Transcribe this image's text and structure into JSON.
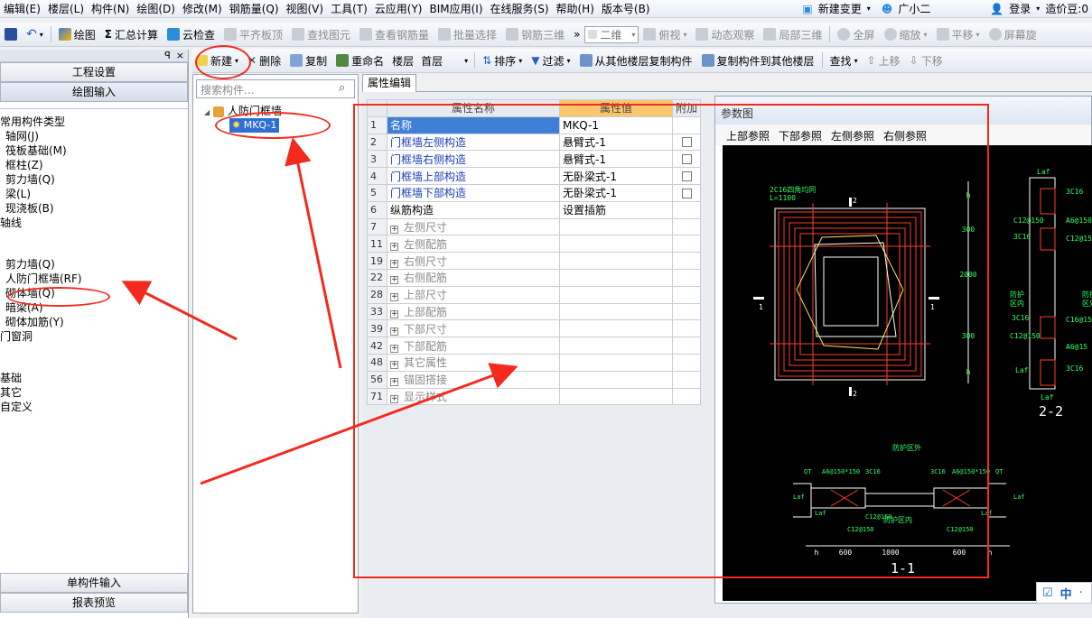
{
  "menu": [
    "编辑(E)",
    "楼层(L)",
    "构件(N)",
    "绘图(D)",
    "修改(M)",
    "钢筋量(Q)",
    "视图(V)",
    "工具(T)",
    "云应用(Y)",
    "BIM应用(I)",
    "在线服务(S)",
    "帮助(H)",
    "版本号(B)"
  ],
  "menu_extra": {
    "new_change": "新建变更",
    "assistant": "广小二",
    "login": "登录",
    "beans": "造价豆:0"
  },
  "toolbar1": {
    "draw": "绘图",
    "sum": "汇总计算",
    "cloud_check": "云检查",
    "flat_slab": "平齐板顶",
    "find_elem": "查找图元",
    "view_rebar": "查看钢筋量",
    "batch_select": "批量选择",
    "rebar3d": "钢筋三维",
    "view_mode": "二维",
    "top_view": "俯视",
    "dyn_view": "动态观察",
    "local3d": "局部三维",
    "fullscreen": "全屏",
    "zoom": "缩放",
    "pan": "平移",
    "screen_rotate": "屏幕旋"
  },
  "toolbar2": {
    "new": "新建",
    "delete": "删除",
    "copy": "复制",
    "rename": "重命名",
    "floor_label": "楼层",
    "floor_value": "首层",
    "sort": "排序",
    "filter": "过滤",
    "copy_from": "从其他楼层复制构件",
    "copy_to": "复制构件到其他楼层",
    "find": "查找",
    "up": "上移",
    "down": "下移"
  },
  "left": {
    "pin": "ꟼ",
    "close": "×",
    "btn_project": "工程设置",
    "btn_draw": "绘图输入",
    "tree": [
      "常用构件类型",
      "轴网(J)",
      "筏板基础(M)",
      "框柱(Z)",
      "剪力墙(Q)",
      "梁(L)",
      "现浇板(B)",
      "轴线",
      "剪力墙(Q)",
      "人防门框墙(RF)",
      "砌体墙(Q)",
      "暗梁(A)",
      "砌体加筋(Y)",
      "门窗洞",
      "基础",
      "其它",
      "自定义"
    ],
    "btn_single": "单构件输入",
    "btn_report": "报表预览"
  },
  "mid": {
    "search_placeholder": "搜索构件...",
    "root": "人防门框墙",
    "child": "MKQ-1"
  },
  "props": {
    "tab": "属性编辑",
    "headers": [
      "属性名称",
      "属性值",
      "附加"
    ],
    "rows": [
      {
        "n": "1",
        "name": "名称",
        "value": "MKQ-1",
        "style": "sel"
      },
      {
        "n": "2",
        "name": "门框墙左侧构造",
        "value": "悬臂式-1",
        "style": "blue",
        "chk": true
      },
      {
        "n": "3",
        "name": "门框墙右侧构造",
        "value": "悬臂式-1",
        "style": "blue",
        "chk": true
      },
      {
        "n": "4",
        "name": "门框墙上部构造",
        "value": "无卧梁式-1",
        "style": "blue",
        "chk": true
      },
      {
        "n": "5",
        "name": "门框墙下部构造",
        "value": "无卧梁式-1",
        "style": "blue",
        "chk": true
      },
      {
        "n": "6",
        "name": "纵筋构造",
        "value": "设置插筋",
        "style": "plain"
      },
      {
        "n": "7",
        "name": "左侧尺寸",
        "value": "",
        "style": "group"
      },
      {
        "n": "11",
        "name": "左侧配筋",
        "value": "",
        "style": "group"
      },
      {
        "n": "19",
        "name": "右侧尺寸",
        "value": "",
        "style": "group"
      },
      {
        "n": "22",
        "name": "右侧配筋",
        "value": "",
        "style": "group"
      },
      {
        "n": "28",
        "name": "上部尺寸",
        "value": "",
        "style": "group"
      },
      {
        "n": "33",
        "name": "上部配筋",
        "value": "",
        "style": "group"
      },
      {
        "n": "39",
        "name": "下部尺寸",
        "value": "",
        "style": "group"
      },
      {
        "n": "42",
        "name": "下部配筋",
        "value": "",
        "style": "group"
      },
      {
        "n": "48",
        "name": "其它属性",
        "value": "",
        "style": "group"
      },
      {
        "n": "56",
        "name": "锚固搭接",
        "value": "",
        "style": "group"
      },
      {
        "n": "71",
        "name": "显示样式",
        "value": "",
        "style": "group"
      }
    ]
  },
  "param": {
    "title": "参数图",
    "tabs": [
      "上部参照",
      "下部参照",
      "左侧参照",
      "右侧参照"
    ],
    "drawing": {
      "top_label": "2C16四角均同",
      "l_label": "L=1100",
      "sec1": "1",
      "sec2": "2",
      "dims_v": [
        "h",
        "300",
        "2000",
        "300",
        "h"
      ],
      "title22": "2-2",
      "title11": "1-1",
      "right_labels": [
        "Laf",
        "3C16",
        "C12@150",
        "A6@150",
        "3C16",
        "C12@15",
        "防护",
        "区外",
        "防护",
        "区内",
        "3C16",
        "C16@15",
        "C12@150",
        "A6@15",
        "Laf",
        "3C16",
        "Laf"
      ],
      "bottom_top": "防护区外",
      "bottom_mid": "防护区内",
      "bottom_labels": [
        "QT",
        "A6@150*150",
        "3C16",
        "3C16",
        "A6@150*150",
        "QT",
        "Laf",
        "Laf",
        "Laf",
        "Laf",
        "C12@150",
        "C12@150",
        "C12@150"
      ],
      "dims_h": [
        "h",
        "600",
        "1000",
        "600",
        "h"
      ]
    }
  },
  "ime": {
    "a": "☑",
    "b": "中",
    "c": "·"
  }
}
